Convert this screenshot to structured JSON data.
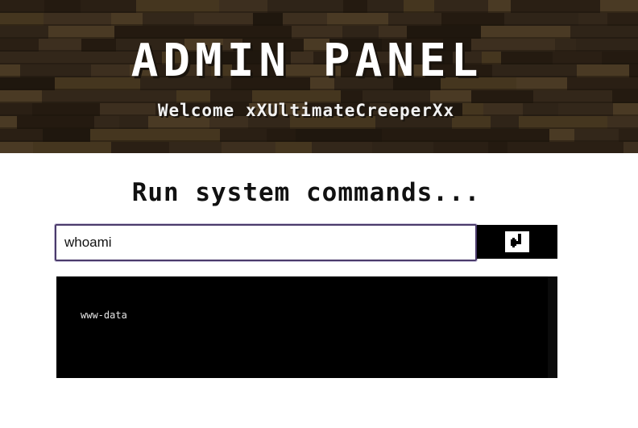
{
  "header": {
    "title": "ADMIN PANEL",
    "welcome": "Welcome xXUltimateCreeperXx",
    "background": "dark-oak-planks-texture"
  },
  "main": {
    "heading": "Run system commands...",
    "command_input": {
      "value": "whoami",
      "placeholder": ""
    },
    "submit_icon": "enter-return-icon",
    "output": {
      "text": "www-data"
    }
  },
  "colors": {
    "header_bg": "#2c2216",
    "input_border": "#4a3b6b",
    "console_bg": "#000000",
    "console_text": "#e6e6e6"
  }
}
